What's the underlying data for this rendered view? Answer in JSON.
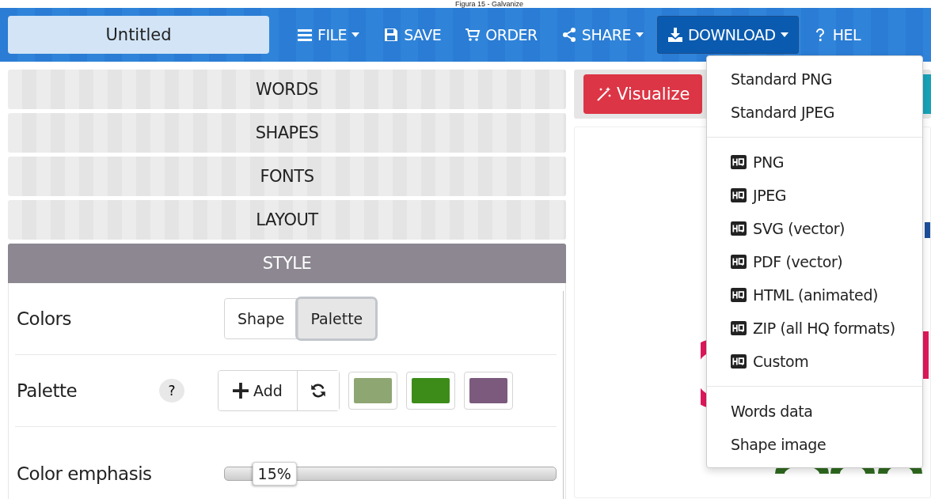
{
  "caption": "Figura 15 - Galvanize",
  "title_field": {
    "value": "Untitled"
  },
  "nav": [
    {
      "label": "FILE",
      "caret": true,
      "selected": false
    },
    {
      "label": "SAVE",
      "caret": false,
      "selected": false
    },
    {
      "label": "ORDER",
      "caret": false,
      "selected": false
    },
    {
      "label": "SHARE",
      "caret": true,
      "selected": false
    },
    {
      "label": "DOWNLOAD",
      "caret": true,
      "selected": true
    },
    {
      "label": "HEL",
      "caret": false,
      "selected": false
    }
  ],
  "sections": [
    {
      "label": "WORDS",
      "expanded": false
    },
    {
      "label": "SHAPES",
      "expanded": false
    },
    {
      "label": "FONTS",
      "expanded": false
    },
    {
      "label": "LAYOUT",
      "expanded": false
    },
    {
      "label": "STYLE",
      "expanded": true
    }
  ],
  "style": {
    "colors_label": "Colors",
    "color_modes": [
      {
        "label": "Shape",
        "selected": false
      },
      {
        "label": "Palette",
        "selected": true
      }
    ],
    "palette_label": "Palette",
    "help": "?",
    "add": "Add",
    "swatches": [
      {
        "color": "#8ea672"
      },
      {
        "color": "#3d8c1a"
      },
      {
        "color": "#7b5a7e"
      }
    ],
    "emphasis_label": "Color emphasis",
    "emphasis": {
      "level": 0.15,
      "reading": "15%"
    }
  },
  "visualize": "Visualize",
  "download_menu": [
    {
      "kind": "plain",
      "items": [
        "Standard PNG",
        "Standard JPEG"
      ]
    },
    {
      "kind": "hq",
      "items": [
        "PNG",
        "JPEG",
        "SVG (vector)",
        "PDF (vector)",
        "HTML (animated)",
        "ZIP (all HQ formats)",
        "Custom"
      ]
    },
    {
      "kind": "plain",
      "items": [
        "Words data",
        "Shape image"
      ]
    }
  ]
}
